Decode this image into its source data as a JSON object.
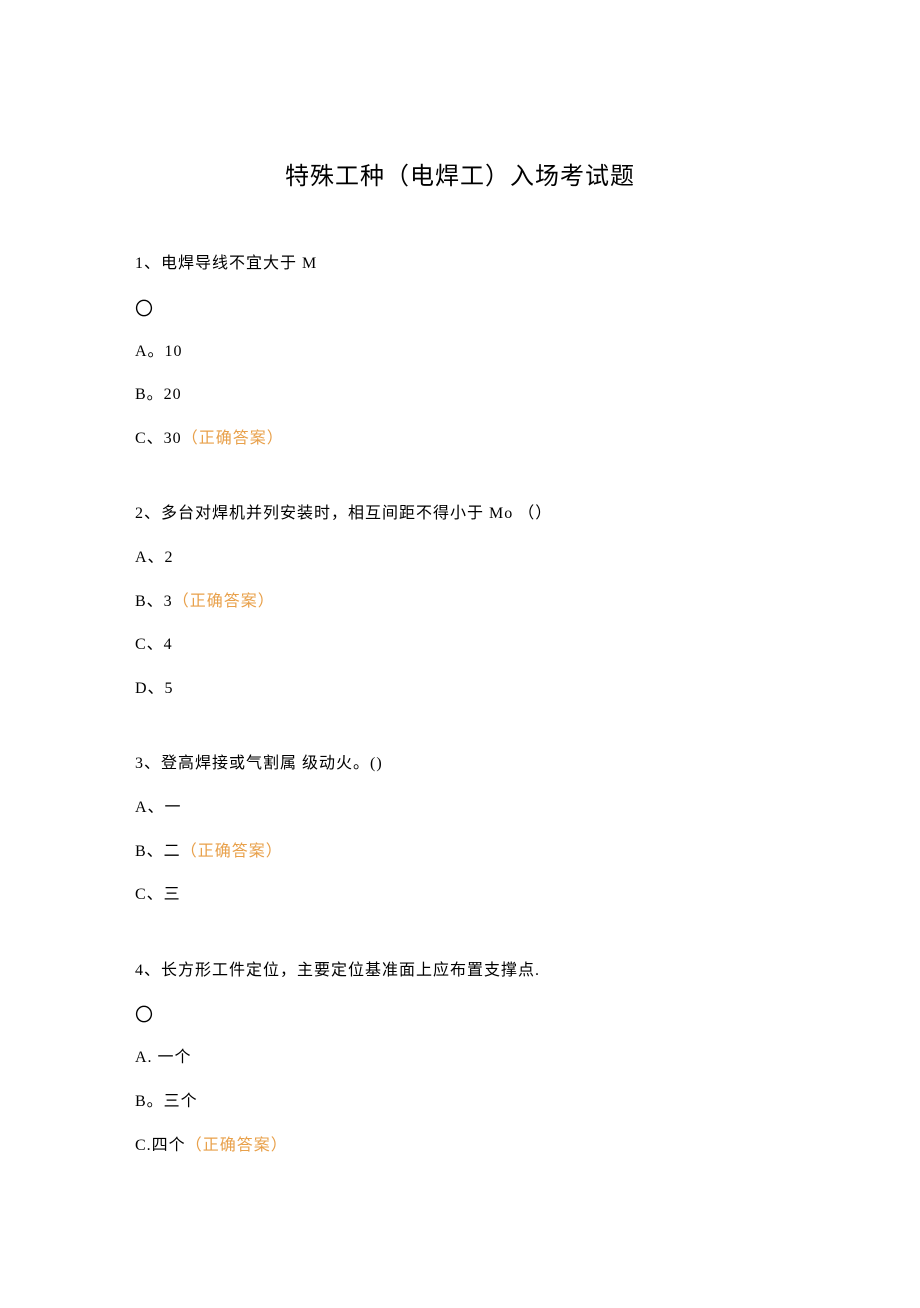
{
  "title": "特殊工种（电焊工）入场考试题",
  "q1": {
    "text": "1、电焊导线不宜大于 M",
    "mark": "〇",
    "optA": "A。10",
    "optB": "B。20",
    "optC_prefix": "C、30",
    "optC_correct": "（正确答案）"
  },
  "q2": {
    "text": "2、多台对焊机并列安装时，相互间距不得小于 Mo （）",
    "optA": "A、2",
    "optB_prefix": "B、3",
    "optB_correct": "（正确答案）",
    "optC": "C、4",
    "optD": "D、5"
  },
  "q3": {
    "text": "3、登高焊接或气割属 级动火。()",
    "optA": "A、一",
    "optB_prefix": "B、二",
    "optB_correct": "（正确答案）",
    "optC": "C、三"
  },
  "q4": {
    "text": "4、长方形工件定位，主要定位基准面上应布置支撑点.",
    "mark": "〇",
    "optA": "A. 一个",
    "optB": "B。三个",
    "optC_prefix": "C.四个",
    "optC_correct": "（正确答案）"
  }
}
